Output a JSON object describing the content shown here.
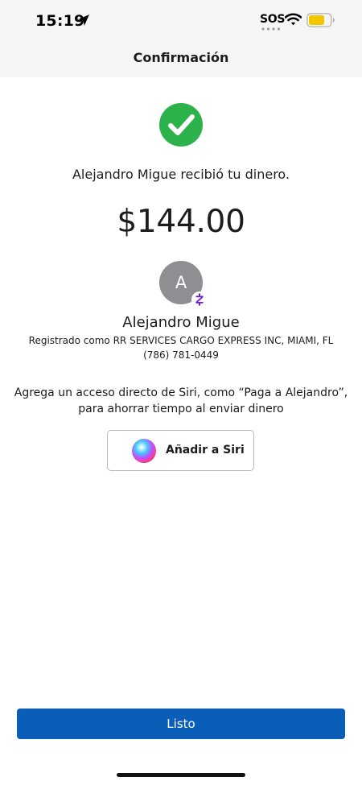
{
  "status_bar": {
    "time": "15:19",
    "sos": "SOS",
    "icons": [
      "location-arrow-icon",
      "wifi-icon",
      "battery-icon"
    ],
    "battery_color": "#f2c700"
  },
  "header": {
    "title": "Confirmación"
  },
  "confirmation": {
    "message": "Alejandro Migue recibió tu dinero.",
    "amount": "$144.00",
    "success_color": "#2cb24a"
  },
  "recipient": {
    "avatar_initial": "A",
    "name": "Alejandro Migue",
    "registered": "Registrado como RR SERVICES CARGO EXPRESS INC, MIAMI, FL",
    "phone": "(786) 781-0449",
    "badge_color": "#6d1ed4"
  },
  "siri": {
    "prompt_line1": "Agrega un acceso directo de Siri, como “Paga a Alejandro”,",
    "prompt_line2": "para ahorrar tiempo al enviar dinero",
    "button_label": "Añadir a Siri"
  },
  "footer": {
    "done_label": "Listo",
    "button_color": "#0a5eb8"
  }
}
